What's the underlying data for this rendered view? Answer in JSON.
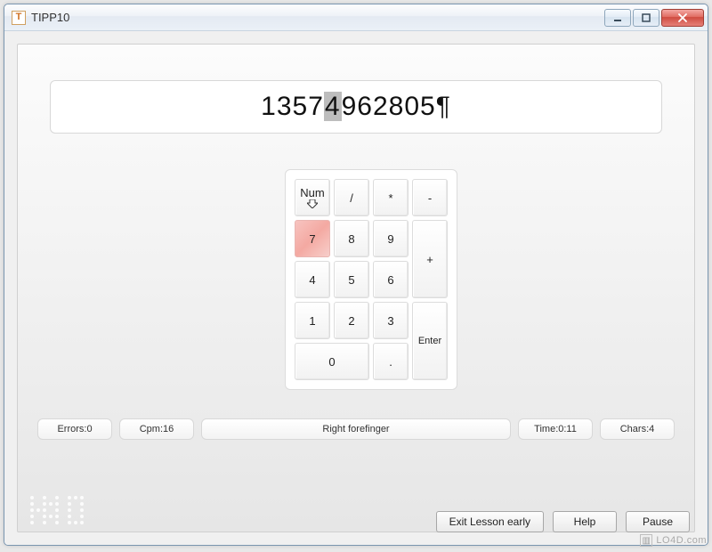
{
  "window": {
    "title": "TIPP10",
    "icon_letter": "T"
  },
  "ticker": {
    "typed": "1357",
    "cursor": "4",
    "rest": "962805¶"
  },
  "numpad": {
    "keys": {
      "num": "Num",
      "divide": "/",
      "multiply": "*",
      "minus": "-",
      "k7": "7",
      "k8": "8",
      "k9": "9",
      "plus": "+",
      "k4": "4",
      "k5": "5",
      "k6": "6",
      "k1": "1",
      "k2": "2",
      "k3": "3",
      "enter": "Enter",
      "k0": "0",
      "dot": "."
    },
    "highlight_key": "k7"
  },
  "status": {
    "errors_label": "Errors: ",
    "errors_value": "0",
    "cpm_label": "Cpm: ",
    "cpm_value": "16",
    "finger": "Right forefinger",
    "time_label": "Time: ",
    "time_value": "0:11",
    "chars_label": "Chars: ",
    "chars_value": "4"
  },
  "buttons": {
    "exit": "Exit Lesson early",
    "help": "Help",
    "pause": "Pause"
  },
  "watermark": {
    "brand": "TIPP 10",
    "site": "LO4D.com"
  },
  "colors": {
    "highlight": "#f4a9a2",
    "window_border": "#7a96b0",
    "close_red": "#cf4b40"
  }
}
